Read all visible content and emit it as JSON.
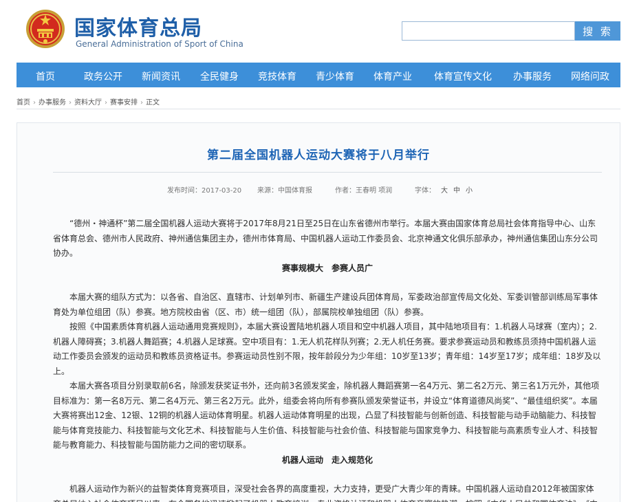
{
  "header": {
    "title_cn": "国家体育总局",
    "title_en": "General Administration of Sport of China"
  },
  "search": {
    "placeholder": "",
    "button_label": "搜 索"
  },
  "nav": {
    "items": [
      "首页",
      "政务公开",
      "新闻资讯",
      "全民健身",
      "竞技体育",
      "青少体育",
      "体育产业",
      "体育宣传文化",
      "办事服务",
      "网络问政"
    ]
  },
  "breadcrumb": [
    "首页",
    "办事服务",
    "资料大厅",
    "赛事安排",
    "正文"
  ],
  "article": {
    "title": "第二届全国机器人运动大赛将于八月举行",
    "meta": {
      "date": "发布时间：2017-03-20",
      "source": "来源：中国体育报",
      "author": "作者：王春明  项润",
      "font_label": "字体：",
      "font_large": "大",
      "font_medium": "中",
      "font_small": "小"
    },
    "p1": "“德州・神通杯”第二届全国机器人运动大赛将于2017年8月21日至25日在山东省德州市举行。本届大赛由国家体育总局社会体育指导中心、山东省体育总会、德州市人民政府、神州通信集团主办，德州市体育局、中国机器人运动工作委员会、北京神通文化俱乐部承办，神州通信集团山东分公司协办。",
    "subhead1": "赛事规模大　参赛人员广",
    "p2": "本届大赛的组队方式为：以各省、自治区、直辖市、计划单列市、新疆生产建设兵团体育局，军委政治部宣传局文化处、军委训管部训练局军事体育处为单位组团（队）参赛。地方院校由省（区、市）统一组团（队），部属院校单独组团（队）参赛。",
    "p3": "按照《中国素质体育机器人运动通用竞赛规则》，本届大赛设置陆地机器人项目和空中机器人项目，其中陆地项目有：1.机器人马球赛（室内）；2.机器人障碍赛；3.机器人舞蹈赛；4.机器人足球赛。空中项目有：1.无人机花样队列赛；2.无人机任务赛。要求参赛运动员和教练员须持中国机器人运动工作委员会颁发的运动员和教练员资格证书。参赛运动员性别不限，按年龄段分为少年组：10岁至13岁；青年组：14岁至17岁；成年组：18岁及以上。",
    "p4": "本届大赛各项目分别录取前6名，除颁发获奖证书外，还向前3名颁发奖金，除机器人舞蹈赛第一名4万元、第二名2万元、第三名1万元外，其他项目标准为：第一名8万元、第二名4万元、第三名2万元。此外，组委会将向所有参赛队颁发荣誉证书，并设立“体育道德风尚奖”、“最佳组织奖”。本届大赛将赛出12金、12银、12铜的机器人运动体育明星。机器人运动体育明星的出现，凸显了科技智能与创新创造、科技智能与动手动脑能力、科技智能与体育竞技能力、科技智能与文化艺术、科技智能与人生价值、科技智能与社会价值、科技智能与国家竞争力、科技智能与高素质专业人才、科技智能与教育能力、科技智能与国防能力之间的密切联系。",
    "subhead2": "机器人运动　走入规范化",
    "p5": "机器人运动作为新兴的益智类体育竞赛项目，深受社会各界的高度重视，大力支持，更受广大青少年的青睐。中国机器人运动自2012年被国家体育总局纳入社会体育项目以来，在全国各地迅速掀起了机器人教育培训、专业资格认证和机器人体育竞赛的热潮。按照《中华人民共和国体育法》、《中国素质体"
  }
}
